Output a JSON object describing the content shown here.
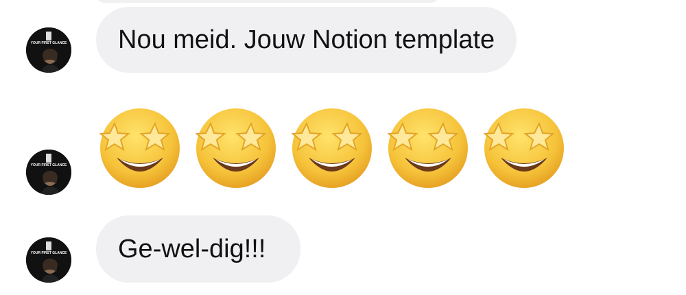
{
  "conversation": {
    "messages": [
      {
        "type": "text",
        "text": "Nou meid. Jouw Notion template"
      },
      {
        "type": "emoji",
        "emoji": [
          "star-struck",
          "star-struck",
          "star-struck",
          "star-struck",
          "star-struck"
        ]
      },
      {
        "type": "text",
        "text": "Ge-wel-dig!!!"
      }
    ],
    "avatar_text": "YOUR FIRST GLANCE"
  },
  "colors": {
    "bubble": "#f0f0f3",
    "emoji_face": "#f6c33a",
    "star": "#ffe89a"
  }
}
